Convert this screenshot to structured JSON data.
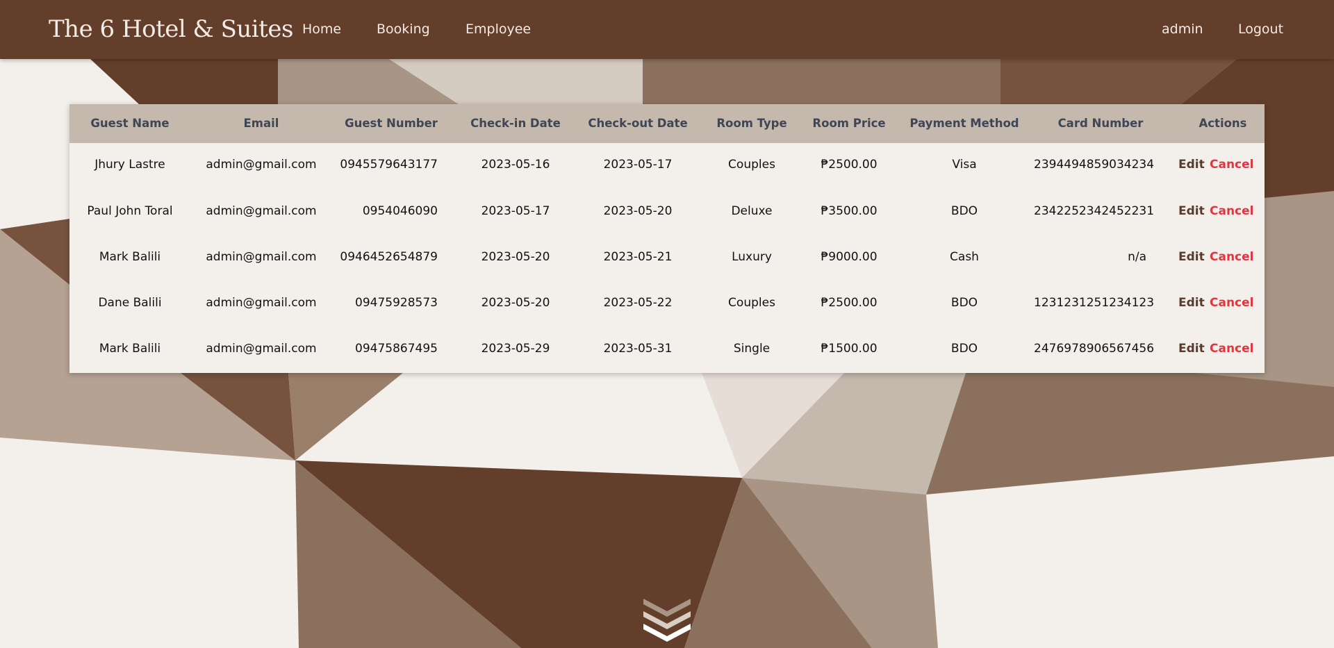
{
  "navbar": {
    "brand": "The 6 Hotel & Suites",
    "links": [
      "Home",
      "Booking",
      "Employee"
    ],
    "user": "admin",
    "logout": "Logout"
  },
  "table": {
    "headers": [
      "Guest Name",
      "Email",
      "Guest Number",
      "Check-in Date",
      "Check-out Date",
      "Room Type",
      "Room Price",
      "Payment Method",
      "Card Number",
      "Actions"
    ],
    "rows": [
      {
        "name": "Jhury Lastre",
        "email": "admin@gmail.com",
        "number": "0945579643177",
        "checkin": "2023-05-16",
        "checkout": "2023-05-17",
        "room": "Couples",
        "price": "₱2500.00",
        "payment": "Visa",
        "card": "2394494859034234",
        "edit": "Edit",
        "cancel": "Cancel"
      },
      {
        "name": "Paul John Toral",
        "email": "admin@gmail.com",
        "number": "0954046090",
        "checkin": "2023-05-17",
        "checkout": "2023-05-20",
        "room": "Deluxe",
        "price": "₱3500.00",
        "payment": "BDO",
        "card": "2342252342452231",
        "edit": "Edit",
        "cancel": "Cancel"
      },
      {
        "name": "Mark Balili",
        "email": "admin@gmail.com",
        "number": "0946452654879",
        "checkin": "2023-05-20",
        "checkout": "2023-05-21",
        "room": "Luxury",
        "price": "₱9000.00",
        "payment": "Cash",
        "card": "n/a",
        "edit": "Edit",
        "cancel": "Cancel"
      },
      {
        "name": "Dane Balili",
        "email": "admin@gmail.com",
        "number": "09475928573",
        "checkin": "2023-05-20",
        "checkout": "2023-05-22",
        "room": "Couples",
        "price": "₱2500.00",
        "payment": "BDO",
        "card": "1231231251234123",
        "edit": "Edit",
        "cancel": "Cancel"
      },
      {
        "name": "Mark Balili",
        "email": "admin@gmail.com",
        "number": "09475867495",
        "checkin": "2023-05-29",
        "checkout": "2023-05-31",
        "room": "Single",
        "price": "₱1500.00",
        "payment": "BDO",
        "card": "2476978906567456",
        "edit": "Edit",
        "cancel": "Cancel"
      }
    ]
  },
  "icons": {
    "scroll": "double-chevron-down-icon"
  },
  "colors": {
    "navbar": "#633e2b",
    "table_header": "#c5b8ad",
    "table_body": "#f3f0ec",
    "edit": "#5b3b2b",
    "cancel": "#e3343f"
  }
}
